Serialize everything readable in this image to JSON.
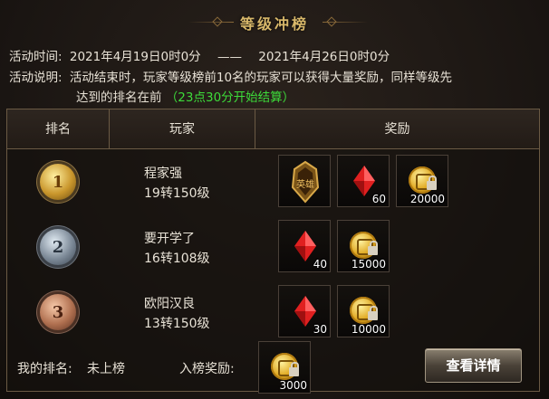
{
  "title": "等级冲榜",
  "activity": {
    "time_label": "活动时间:",
    "start": "2021年4月19日0时0分",
    "dash": "——",
    "end": "2021年4月26日0时0分",
    "desc_label": "活动说明:",
    "desc_line1": "活动结束时，玩家等级榜前10名的玩家可以获得大量奖励，同样等级先",
    "desc_line2": "达到的排名在前",
    "desc_green": "（23点30分开始结算）"
  },
  "table": {
    "headers": [
      "排名",
      "玩家",
      "奖励"
    ],
    "rows": [
      {
        "rank": "1",
        "name": "程家强",
        "level": "19转150级",
        "rewards": [
          {
            "type": "relic",
            "icon": "hero-relic-icon",
            "count": ""
          },
          {
            "type": "gem",
            "icon": "red-gem-icon",
            "count": "60"
          },
          {
            "type": "coin",
            "icon": "bound-gold-coin-icon",
            "count": "20000"
          }
        ]
      },
      {
        "rank": "2",
        "name": "要开学了",
        "level": "16转108级",
        "rewards": [
          {
            "type": "gem",
            "icon": "red-gem-icon",
            "count": "40"
          },
          {
            "type": "coin",
            "icon": "bound-gold-coin-icon",
            "count": "15000"
          }
        ]
      },
      {
        "rank": "3",
        "name": "欧阳汉良",
        "level": "13转150级",
        "rewards": [
          {
            "type": "gem",
            "icon": "red-gem-icon",
            "count": "30"
          },
          {
            "type": "coin",
            "icon": "bound-gold-coin-icon",
            "count": "10000"
          }
        ]
      }
    ]
  },
  "footer": {
    "my_rank_label": "我的排名:",
    "my_rank_value": "未上榜",
    "entry_reward_label": "入榜奖励:",
    "entry_reward": {
      "type": "coin",
      "icon": "bound-gold-coin-icon",
      "count": "3000"
    },
    "detail_button": "查看详情"
  },
  "colors": {
    "accent_gold": "#d8b86a",
    "highlight_green": "#3ddc3a",
    "border": "#6b5a44"
  }
}
